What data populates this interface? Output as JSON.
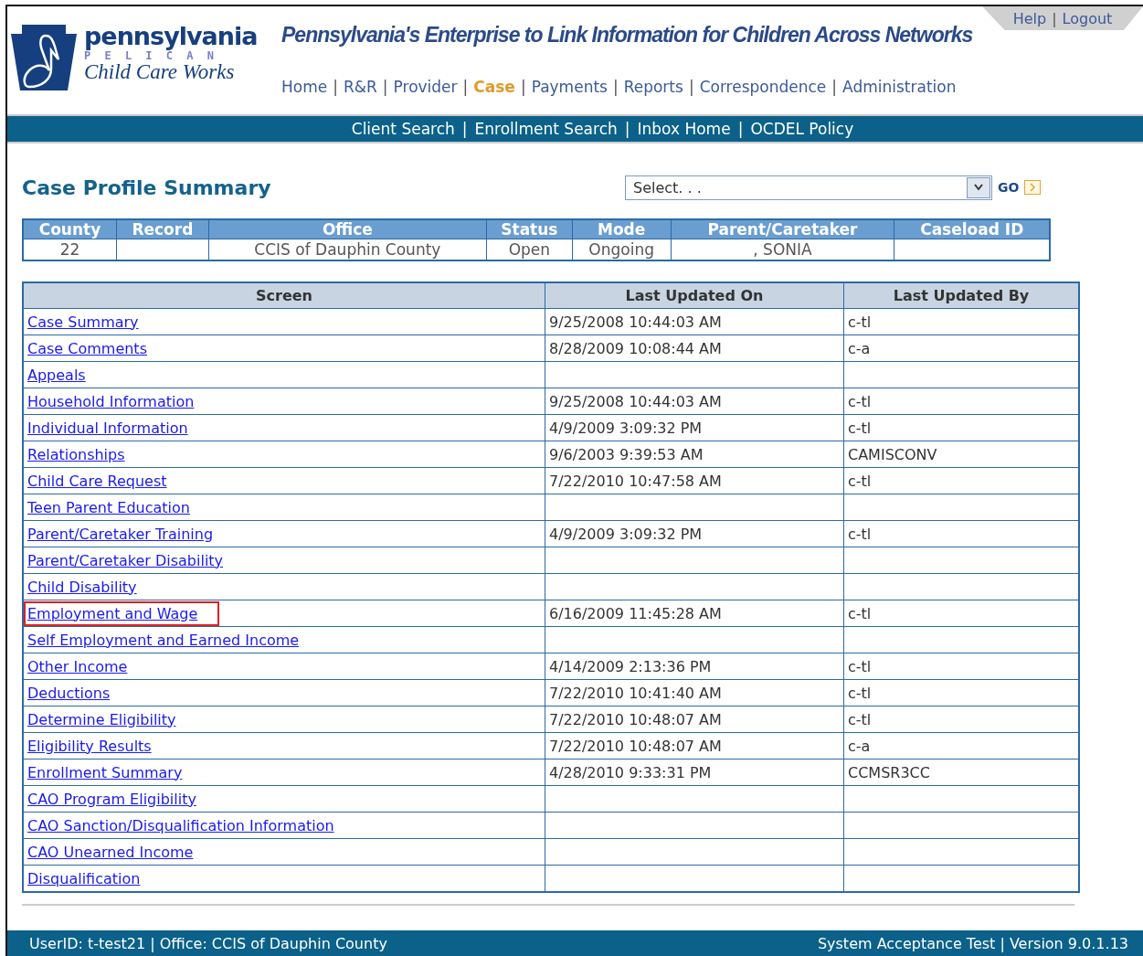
{
  "logo": {
    "name": "pennsylvania",
    "sub": "P E L I C A N",
    "program": "Child Care Works"
  },
  "tagline": "Pennsylvania's Enterprise to Link Information for Children Across Networks",
  "top_links": {
    "separator": "|",
    "items": [
      {
        "label": "Help"
      },
      {
        "label": "Logout"
      }
    ]
  },
  "main_nav": {
    "separator": "|",
    "items": [
      {
        "label": "Home",
        "selected": false
      },
      {
        "label": "R&R",
        "selected": false
      },
      {
        "label": "Provider",
        "selected": false
      },
      {
        "label": "Case",
        "selected": true
      },
      {
        "label": "Payments",
        "selected": false
      },
      {
        "label": "Reports",
        "selected": false
      },
      {
        "label": "Correspondence",
        "selected": false
      },
      {
        "label": "Administration",
        "selected": false
      }
    ]
  },
  "sub_nav": {
    "separator": "|",
    "items": [
      {
        "label": "Client Search"
      },
      {
        "label": "Enrollment Search"
      },
      {
        "label": "Inbox Home"
      },
      {
        "label": "OCDEL Policy"
      }
    ]
  },
  "page_title": "Case Profile Summary",
  "action_select": {
    "value": "Select. . .",
    "go": "GO"
  },
  "summary": {
    "columns": [
      "County",
      "Record",
      "Office",
      "Status",
      "Mode",
      "Parent/Caretaker",
      "Caseload ID"
    ],
    "row": {
      "county": "22",
      "office": "CCIS of Dauphin County",
      "status": "Open",
      "mode": "Ongoing",
      "parent_caretaker": ", SONIA"
    }
  },
  "screens": {
    "columns": [
      "Screen",
      "Last Updated On",
      "Last Updated By"
    ],
    "rows": [
      {
        "screen": "Case Summary",
        "updated_on": "9/25/2008 10:44:03 AM",
        "updated_by": "c-tl",
        "highlighted": false
      },
      {
        "screen": "Case Comments",
        "updated_on": "8/28/2009 10:08:44 AM",
        "updated_by": "c-a",
        "highlighted": false
      },
      {
        "screen": "Appeals",
        "highlighted": false
      },
      {
        "screen": "Household Information",
        "updated_on": "9/25/2008 10:44:03 AM",
        "updated_by": "c-tl",
        "highlighted": false
      },
      {
        "screen": "Individual Information",
        "updated_on": "4/9/2009 3:09:32 PM",
        "updated_by": "c-tl",
        "highlighted": false
      },
      {
        "screen": "Relationships",
        "updated_on": "9/6/2003 9:39:53 AM",
        "updated_by": "CAMISCONV",
        "highlighted": false
      },
      {
        "screen": "Child Care Request",
        "updated_on": "7/22/2010 10:47:58 AM",
        "updated_by": "c-tl",
        "highlighted": false
      },
      {
        "screen": "Teen Parent Education",
        "highlighted": false
      },
      {
        "screen": "Parent/Caretaker Training",
        "updated_on": "4/9/2009 3:09:32 PM",
        "updated_by": "c-tl",
        "highlighted": false
      },
      {
        "screen": "Parent/Caretaker Disability",
        "highlighted": false
      },
      {
        "screen": "Child Disability",
        "highlighted": false
      },
      {
        "screen": "Employment and Wage",
        "updated_on": "6/16/2009 11:45:28 AM",
        "updated_by": "c-tl",
        "highlighted": true
      },
      {
        "screen": "Self Employment and Earned Income",
        "highlighted": false
      },
      {
        "screen": "Other Income",
        "updated_on": "4/14/2009 2:13:36 PM",
        "updated_by": "c-tl",
        "highlighted": false
      },
      {
        "screen": "Deductions",
        "updated_on": "7/22/2010 10:41:40 AM",
        "updated_by": "c-tl",
        "highlighted": false
      },
      {
        "screen": "Determine Eligibility",
        "updated_on": "7/22/2010 10:48:07 AM",
        "updated_by": "c-tl",
        "highlighted": false
      },
      {
        "screen": "Eligibility Results",
        "updated_on": "7/22/2010 10:48:07 AM",
        "updated_by": "c-a",
        "highlighted": false
      },
      {
        "screen": "Enrollment Summary",
        "updated_on": "4/28/2010 9:33:31 PM",
        "updated_by": "CCMSR3CC",
        "highlighted": false
      },
      {
        "screen": "CAO Program Eligibility",
        "highlighted": false
      },
      {
        "screen": "CAO Sanction/Disqualification Information",
        "highlighted": false
      },
      {
        "screen": "CAO Unearned Income",
        "highlighted": false
      },
      {
        "screen": "Disqualification",
        "highlighted": false
      }
    ]
  },
  "status_bar": {
    "left": "UserID: t-test21 | Office: CCIS of Dauphin County",
    "right": "System Acceptance Test | Version 9.0.1.13"
  }
}
